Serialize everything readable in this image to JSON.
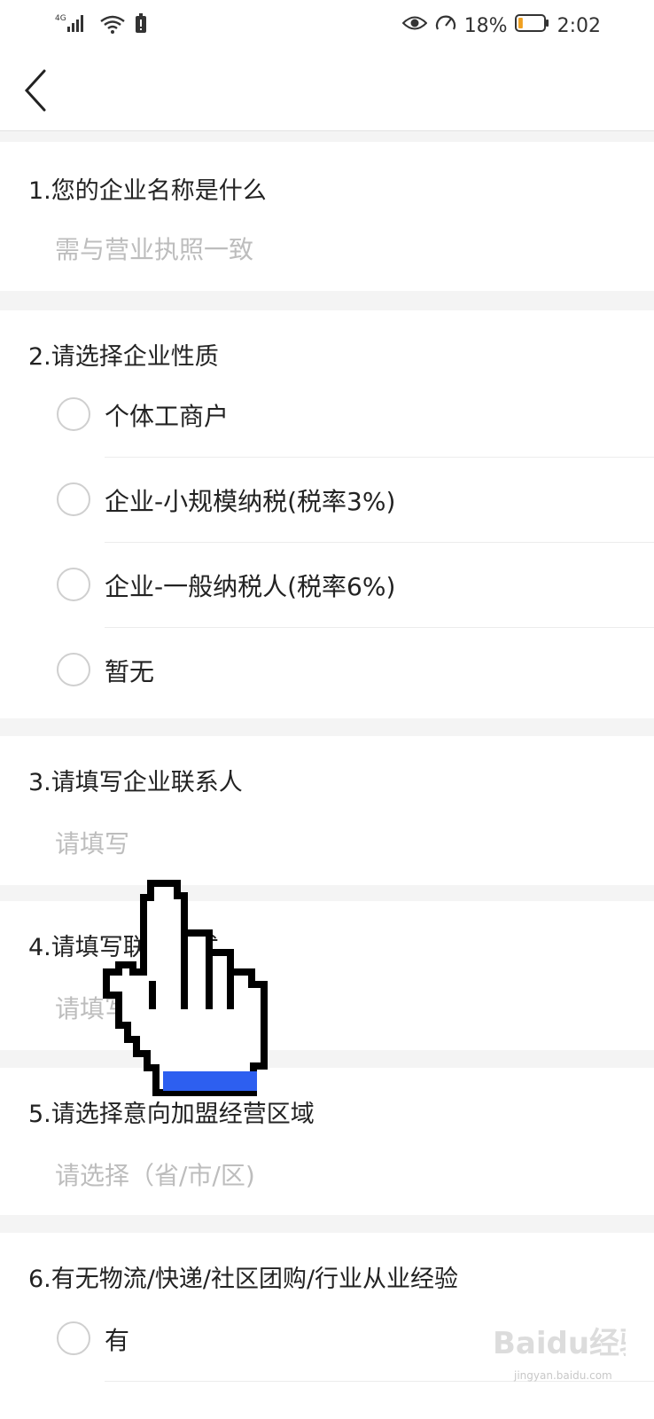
{
  "status_bar": {
    "network": "4G",
    "battery_percent": "18%",
    "battery_level": 0.18,
    "time": "2:02",
    "icons": [
      "signal-icon",
      "wifi-icon",
      "notification-icon",
      "eye-icon",
      "speed-icon",
      "battery-icon"
    ]
  },
  "nav": {
    "back_icon": "chevron-left-icon"
  },
  "questions": {
    "q1": {
      "title": "1.您的企业名称是什么",
      "placeholder": "需与营业执照一致"
    },
    "q2": {
      "title": "2.请选择企业性质",
      "options": [
        "个体工商户",
        "企业-小规模纳税(税率3%)",
        "企业-一般纳税人(税率6%)",
        "暂无"
      ]
    },
    "q3": {
      "title": "3.请填写企业联系人",
      "placeholder": "请填写"
    },
    "q4": {
      "title": "4.请填写联系方式",
      "placeholder": "请填写"
    },
    "q5": {
      "title": "5.请选择意向加盟经营区域",
      "placeholder": "请选择（省/市/区)"
    },
    "q6": {
      "title": "6.有无物流/快递/社区团购/行业从业经验",
      "options": [
        "有"
      ]
    }
  },
  "watermark": {
    "logo": "Baidu经验",
    "sub": "jingyan.baidu.com"
  },
  "colors": {
    "accent_blue": "#2d5ff0",
    "placeholder_gray": "#bdbdbd",
    "battery_orange": "#f0a020"
  }
}
